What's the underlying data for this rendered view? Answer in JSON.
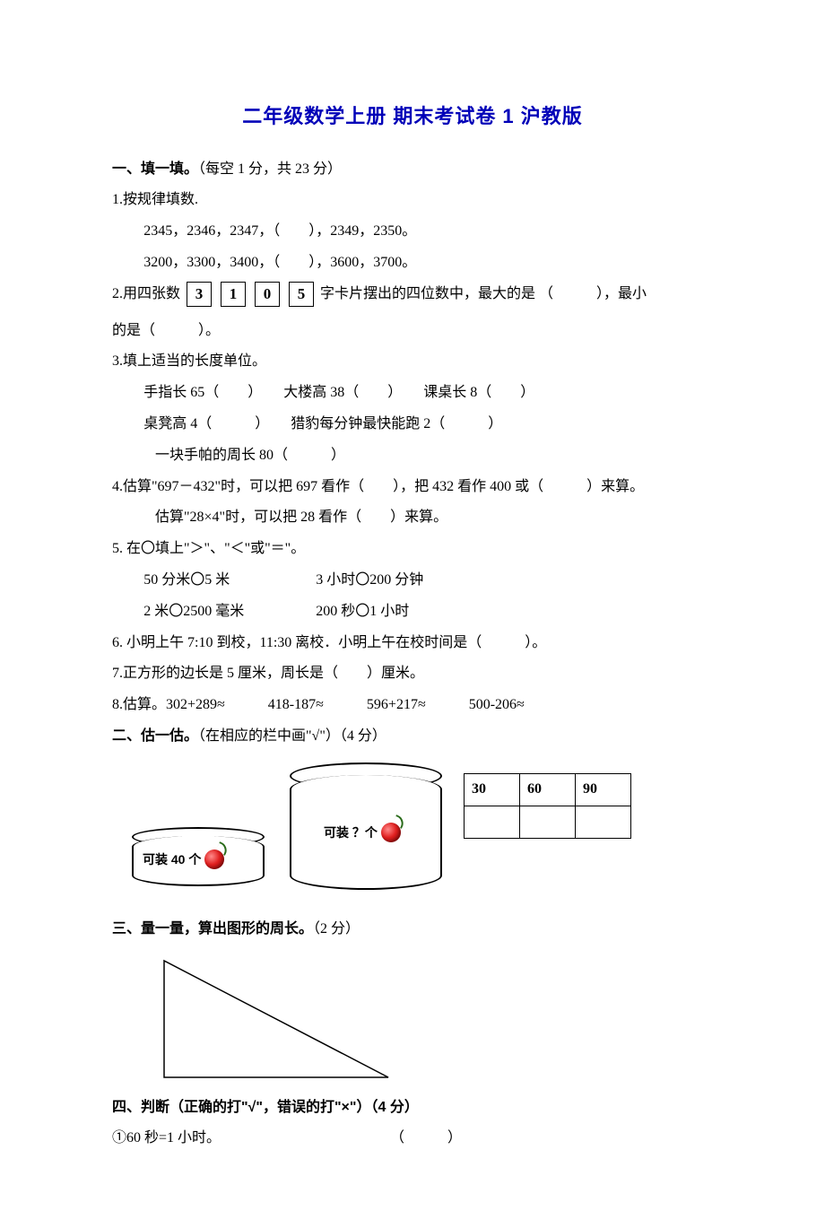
{
  "title": "二年级数学上册 期末考试卷 1 沪教版",
  "s1": {
    "head_bold": "一、填一填。",
    "head_rest": "（每空 1 分，共 23 分）",
    "q1": {
      "label": "1.按规律填数.",
      "seq_a": "2345，2346，2347，（　　），2349，2350。",
      "seq_b": "3200，3300，3400，（　　），3600，3700。"
    },
    "q2": {
      "prefix": "2.用四张数",
      "cards": [
        "3",
        "1",
        "0",
        "5"
      ],
      "mid": "字卡片摆出的四位数中，最大的是 （　　　），最小",
      "line2": "的是（　　　）。"
    },
    "q3": {
      "label": "3.填上适当的长度单位。",
      "a": "手指长 65（　　）　　大楼高 38（　　）　　课桌长 8（　　）",
      "b": "桌凳高 4（　　　）　　猎豹每分钟最快能跑 2（　　　）",
      "c": "一块手帕的周长 80（　　　）"
    },
    "q4": {
      "a": "4.估算\"697－432\"时，可以把 697 看作（　　），把 432 看作 400 或（　　　）来算。",
      "b": "估算\"28×4\"时，可以把 28 看作（　　）来算。"
    },
    "q5": {
      "label": "5. 在〇填上\"＞\"、\"＜\"或\"＝\"。",
      "a": "50 分米〇5 米　　　　　　3 小时〇200 分钟",
      "b": "2 米〇2500 毫米　　　　　200 秒〇1 小时"
    },
    "q6": "6. 小明上午 7:10 到校，11:30 离校．小明上午在校时间是（　　　）。",
    "q7": "7.正方形的边长是 5 厘米，周长是（　　）厘米。",
    "q8": "8.估算。302+289≈　　　418-187≈　　　596+217≈　　　500-206≈"
  },
  "s2": {
    "head_bold": "二、估一估。",
    "head_rest": "（在相应的栏中画\"√\"）（4 分）",
    "small_label": "可装 40 个",
    "big_label": "可装 ？个",
    "table_headers": [
      "30",
      "60",
      "90"
    ]
  },
  "s3": {
    "head_bold": " 三、量一量，算出图形的周长。",
    "head_rest": "（2 分）"
  },
  "s4": {
    "head_bold": "四、判断（正确的打\"√\"，错误的打\"×\"）（4 分）",
    "q1": "①60 秒=1 小时。",
    "paren": "（　　　）"
  }
}
